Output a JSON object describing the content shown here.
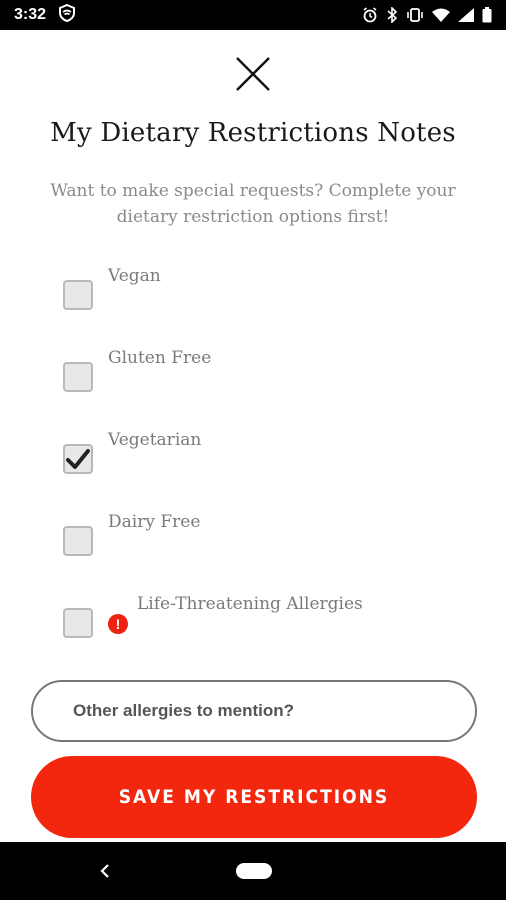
{
  "status_bar": {
    "time": "3:32",
    "icons": [
      "vpn-shield-icon",
      "alarm-icon",
      "bluetooth-icon",
      "vibrate-icon",
      "wifi-icon",
      "signal-icon",
      "battery-icon"
    ]
  },
  "header": {
    "close_icon": "close-icon",
    "title": "My Dietary Restrictions Notes",
    "subtitle": "Want to make special requests? Complete your dietary restriction options first!"
  },
  "options": [
    {
      "label": "Vegan",
      "checked": false
    },
    {
      "label": "Gluten Free",
      "checked": false
    },
    {
      "label": "Vegetarian",
      "checked": true
    },
    {
      "label": "Dairy Free",
      "checked": false
    },
    {
      "label": "Life-Threatening Allergies",
      "checked": false,
      "alert_icon": "alert-icon",
      "alert_symbol": "!"
    }
  ],
  "other_allergies": {
    "placeholder": "Other allergies to mention?",
    "value": ""
  },
  "save_button": {
    "label": "SAVE MY RESTRICTIONS"
  },
  "colors": {
    "accent": "#f3260e",
    "alert": "#ee2211",
    "checkbox_bg": "#e8e8e8",
    "checkbox_border": "#b9b9b9"
  },
  "nav_bar": {
    "back_icon": "back-chevron-icon",
    "home_icon": "home-pill-icon"
  }
}
